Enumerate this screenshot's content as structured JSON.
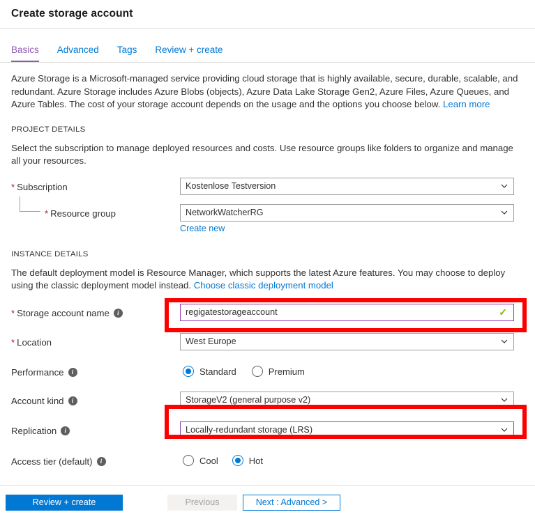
{
  "header": {
    "title": "Create storage account"
  },
  "tabs": [
    {
      "label": "Basics",
      "active": true
    },
    {
      "label": "Advanced",
      "active": false
    },
    {
      "label": "Tags",
      "active": false
    },
    {
      "label": "Review + create",
      "active": false
    }
  ],
  "intro": {
    "text": "Azure Storage is a Microsoft-managed service providing cloud storage that is highly available, secure, durable, scalable, and redundant. Azure Storage includes Azure Blobs (objects), Azure Data Lake Storage Gen2, Azure Files, Azure Queues, and Azure Tables. The cost of your storage account depends on the usage and the options you choose below.",
    "link": "Learn more"
  },
  "project_details": {
    "heading": "PROJECT DETAILS",
    "description": "Select the subscription to manage deployed resources and costs. Use resource groups like folders to organize and manage all your resources.",
    "subscription": {
      "label": "Subscription",
      "required_marker": "*",
      "value": "Kostenlose Testversion"
    },
    "resource_group": {
      "label": "Resource group",
      "required_marker": "*",
      "value": "NetworkWatcherRG",
      "create_new_link": "Create new"
    }
  },
  "instance_details": {
    "heading": "INSTANCE DETAILS",
    "description": "The default deployment model is Resource Manager, which supports the latest Azure features. You may choose to deploy using the classic deployment model instead.",
    "classic_link": "Choose classic deployment model",
    "storage_account_name": {
      "label": "Storage account name",
      "required_marker": "*",
      "value": "regigatestorageaccount",
      "validation": "valid",
      "validation_glyph": "✓",
      "highlighted": true
    },
    "location": {
      "label": "Location",
      "required_marker": "*",
      "value": "West Europe"
    },
    "performance": {
      "label": "Performance",
      "options": [
        {
          "label": "Standard",
          "selected": true
        },
        {
          "label": "Premium",
          "selected": false
        }
      ]
    },
    "account_kind": {
      "label": "Account kind",
      "value": "StorageV2 (general purpose v2)"
    },
    "replication": {
      "label": "Replication",
      "value": "Locally-redundant storage (LRS)",
      "highlighted": true
    },
    "access_tier": {
      "label": "Access tier (default)",
      "options": [
        {
          "label": "Cool",
          "selected": false
        },
        {
          "label": "Hot",
          "selected": true
        }
      ]
    }
  },
  "icons": {
    "info": "i",
    "chevron_down": "chevron-down-icon"
  },
  "footer": {
    "review_create": "Review + create",
    "previous": "Previous",
    "next": "Next : Advanced >"
  },
  "colors": {
    "accent_blue": "#0078d4",
    "active_tab_purple": "#8f5ab2",
    "required_red": "#a4262c",
    "annotation_red": "#ff0000",
    "valid_green": "#7fba00",
    "focus_border_purple": "#8f3faf"
  }
}
